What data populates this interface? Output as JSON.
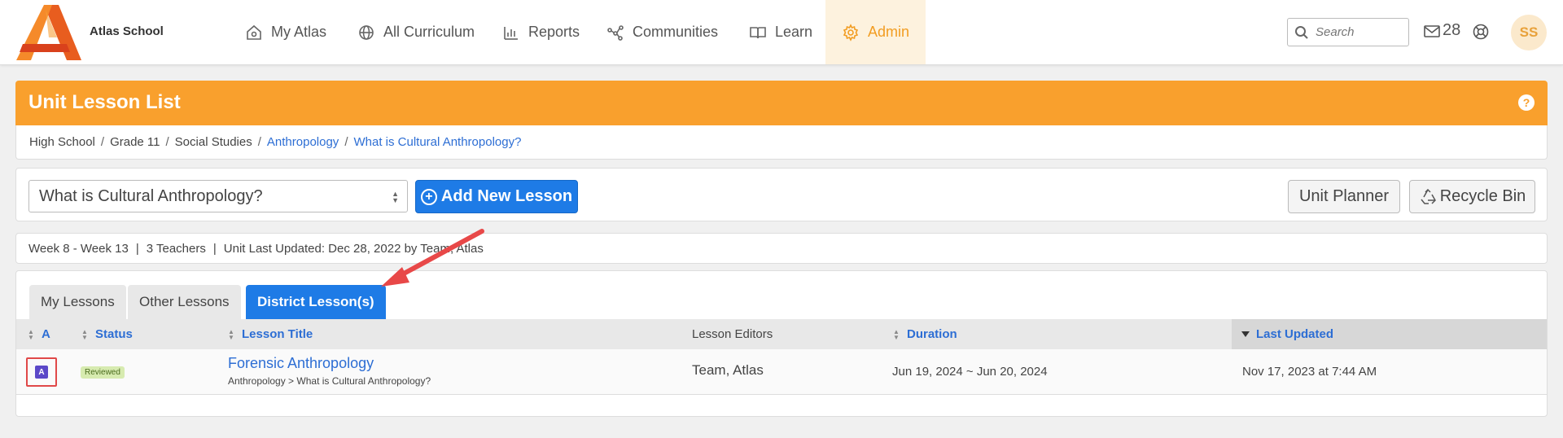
{
  "app": {
    "school_name": "Atlas School",
    "brand_color": "#f9a02d",
    "accent_color": "#1e7be6"
  },
  "nav": {
    "items": [
      {
        "label": "My Atlas",
        "icon": "home-icon"
      },
      {
        "label": "All Curriculum",
        "icon": "globe-icon"
      },
      {
        "label": "Reports",
        "icon": "bar-chart-icon"
      },
      {
        "label": "Communities",
        "icon": "network-icon"
      },
      {
        "label": "Learn",
        "icon": "book-icon"
      },
      {
        "label": "Admin",
        "icon": "gear-icon"
      }
    ],
    "active": "Admin",
    "search_placeholder": "Search",
    "mail_count": "28",
    "avatar_initials": "SS"
  },
  "page": {
    "title": "Unit Lesson List",
    "help": "?",
    "breadcrumb": {
      "plain": [
        "High School",
        "Grade 11",
        "Social Studies"
      ],
      "links": [
        "Anthropology",
        "What is Cultural Anthropology?"
      ],
      "separator": "/"
    }
  },
  "actions": {
    "lesson_select_value": "What is Cultural Anthropology?",
    "add_lesson_label": "Add New Lesson",
    "unit_planner_label": "Unit Planner",
    "recycle_bin_label": "Recycle Bin"
  },
  "info": {
    "weeks": "Week 8 - Week 13",
    "teachers": "3 Teachers",
    "updated": "Unit Last Updated: Dec 28, 2022 by Team, Atlas"
  },
  "tabs": [
    {
      "label": "My Lessons",
      "active": false
    },
    {
      "label": "Other Lessons",
      "active": false
    },
    {
      "label": "District Lesson(s)",
      "active": true
    }
  ],
  "table": {
    "columns": [
      "A",
      "Status",
      "Lesson Title",
      "Lesson Editors",
      "Duration",
      "Last Updated"
    ],
    "rows": [
      {
        "a_badge": "A",
        "status": "Reviewed",
        "title": "Forensic Anthropology",
        "subtitle": "Anthropology > What is Cultural Anthropology?",
        "editors": "Team, Atlas",
        "duration": "Jun 19, 2024 ~ Jun 20, 2024",
        "last_updated": "Nov 17, 2023 at 7:44 AM"
      }
    ]
  }
}
